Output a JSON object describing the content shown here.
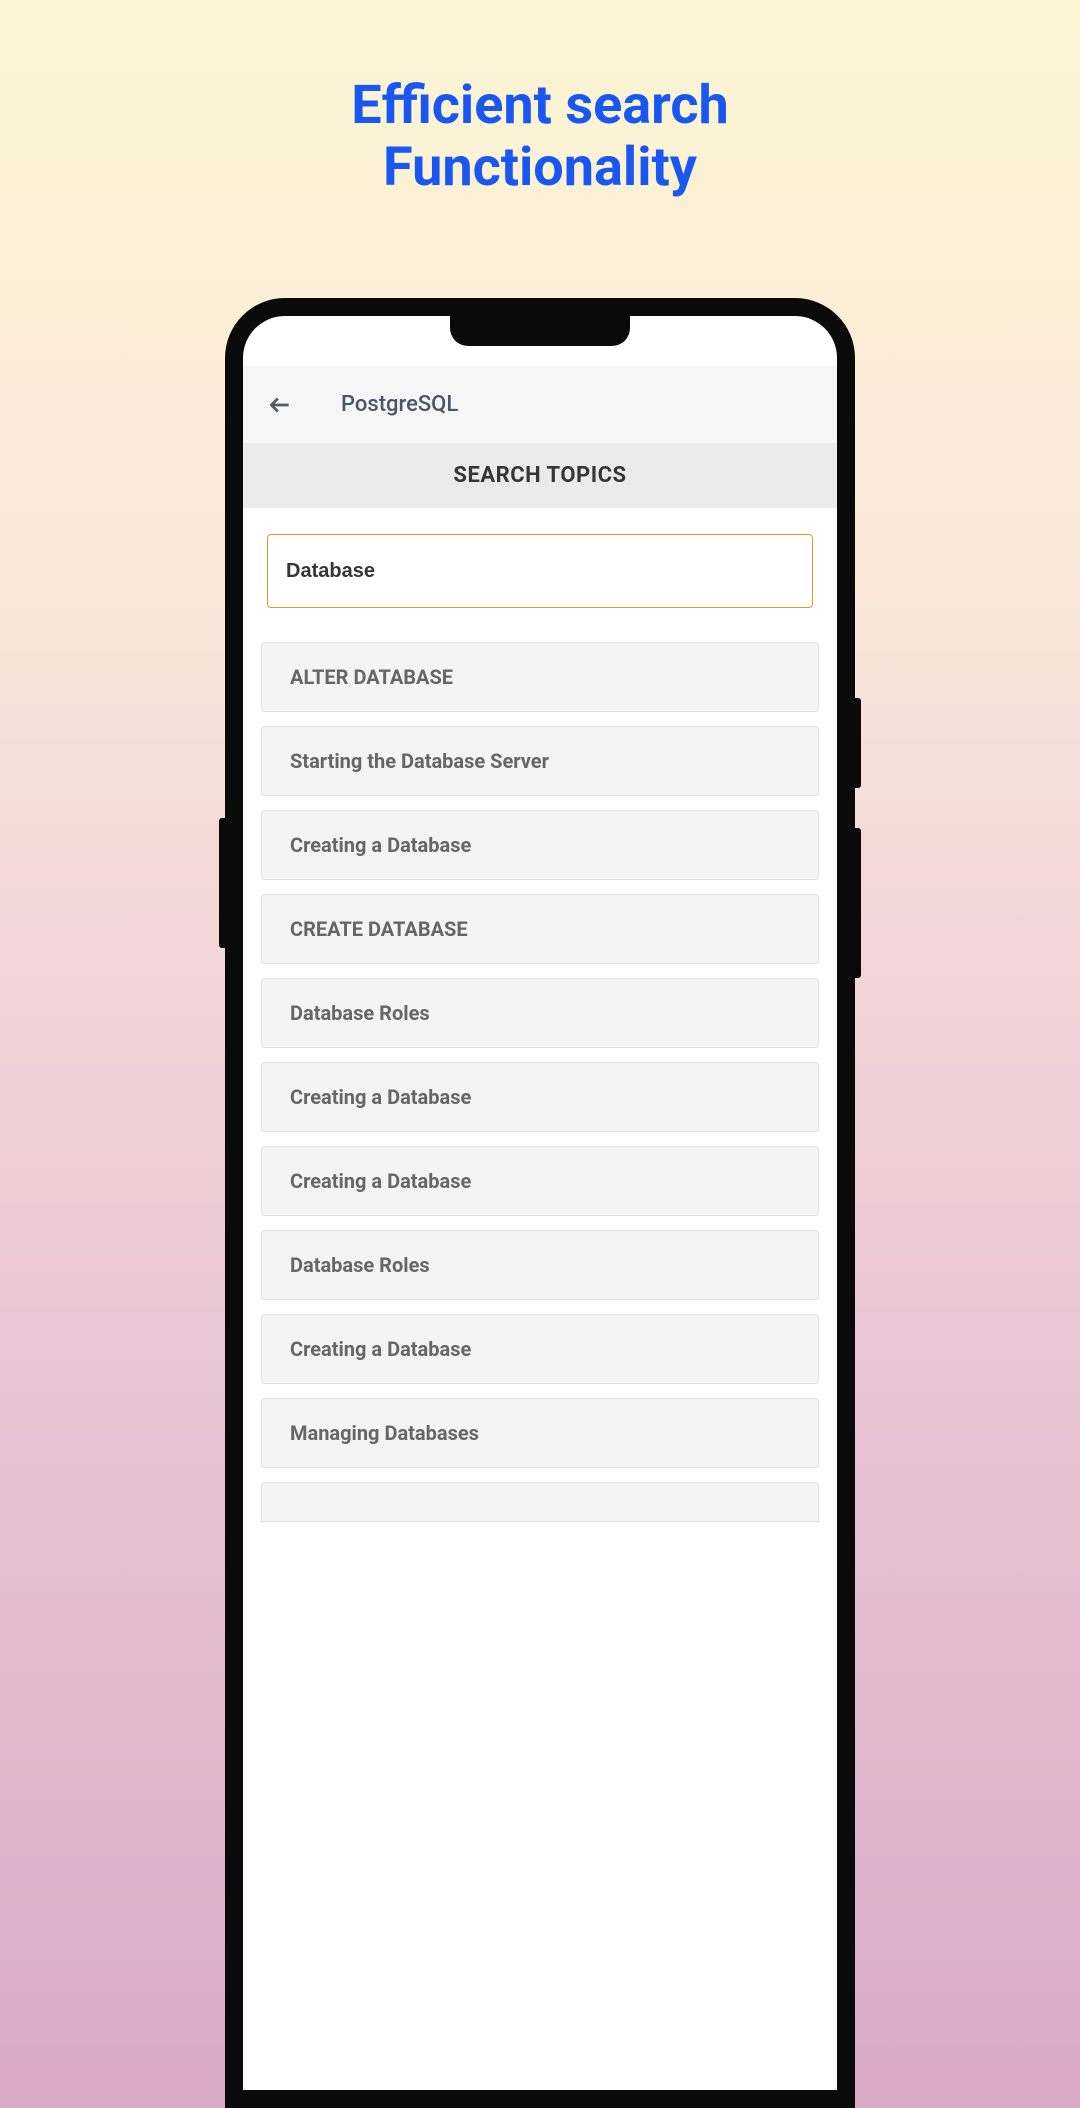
{
  "hero": {
    "line1": "Efficient search",
    "line2": "Functionality"
  },
  "app": {
    "title": "PostgreSQL",
    "section_header": "SEARCH TOPICS",
    "search": {
      "value": "Database"
    },
    "results": [
      {
        "label": "ALTER DATABASE"
      },
      {
        "label": "Starting the Database Server"
      },
      {
        "label": "Creating a Database"
      },
      {
        "label": "CREATE DATABASE"
      },
      {
        "label": "Database Roles"
      },
      {
        "label": "Creating a Database"
      },
      {
        "label": "Creating a Database"
      },
      {
        "label": "Database Roles"
      },
      {
        "label": "Creating a Database"
      },
      {
        "label": "Managing Databases"
      }
    ]
  }
}
